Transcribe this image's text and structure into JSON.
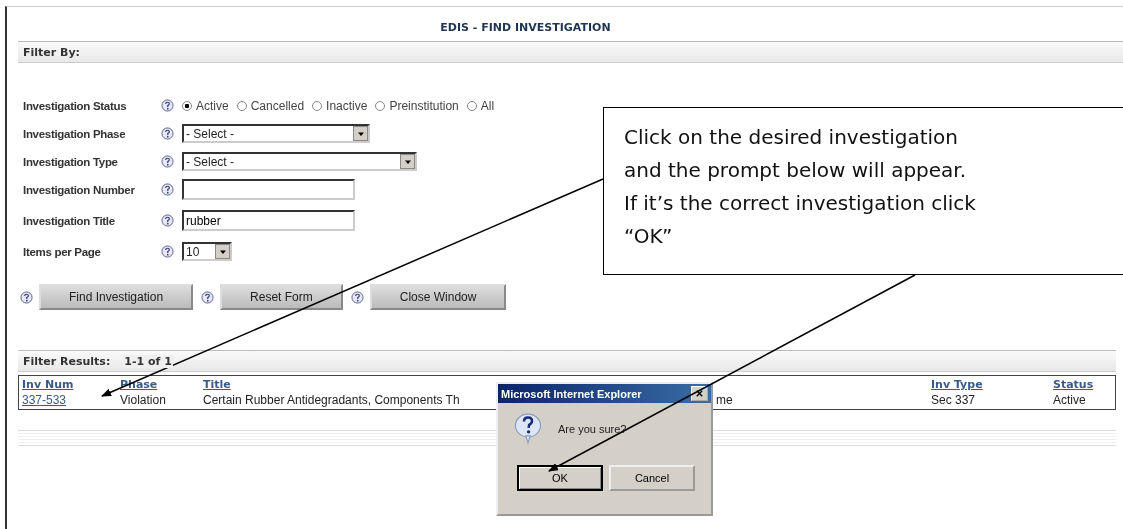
{
  "page_title": "EDIS - FIND INVESTIGATION",
  "filter_by": {
    "heading": "Filter By:"
  },
  "filters": [
    {
      "kind": "radio",
      "label": "Investigation Status",
      "options": [
        {
          "label": "Active",
          "selected": true
        },
        {
          "label": "Cancelled",
          "selected": false
        },
        {
          "label": "Inactive",
          "selected": false
        },
        {
          "label": "Preinstitution",
          "selected": false
        },
        {
          "label": "All",
          "selected": false
        }
      ]
    },
    {
      "kind": "select",
      "label": "Investigation Phase",
      "value": "- Select -"
    },
    {
      "kind": "select",
      "label": "Investigation Type",
      "value": "- Select -"
    },
    {
      "kind": "text",
      "label": "Investigation Number"
    },
    {
      "kind": "text",
      "label": "Investigation Title",
      "value": "rubber"
    },
    {
      "kind": "select",
      "label": "Items per Page",
      "value": "10"
    }
  ],
  "buttons": [
    "Find Investigation",
    "Reset Form",
    "Close Window"
  ],
  "results": {
    "heading": "Filter Results:",
    "count": "1-1 of 1",
    "columns": [
      "Inv Num",
      "Phase",
      "Title",
      "Inv Type",
      "Status"
    ],
    "rows": [
      {
        "inv_num": "337-533",
        "phase": "Violation",
        "title_start": "Certain Rubber Antidegradants, Components Th",
        "title_end": "me",
        "inv_type": "Sec 337",
        "status": "Active"
      }
    ]
  },
  "dialog": {
    "title": "Microsoft Internet Explorer",
    "message": "Are you sure?",
    "buttons": [
      "OK",
      "Cancel"
    ]
  },
  "callout": {
    "lines": [
      "Click on the desired investigation",
      "and the prompt below will appear.",
      "If it’s the correct investigation click",
      "“OK”"
    ]
  }
}
